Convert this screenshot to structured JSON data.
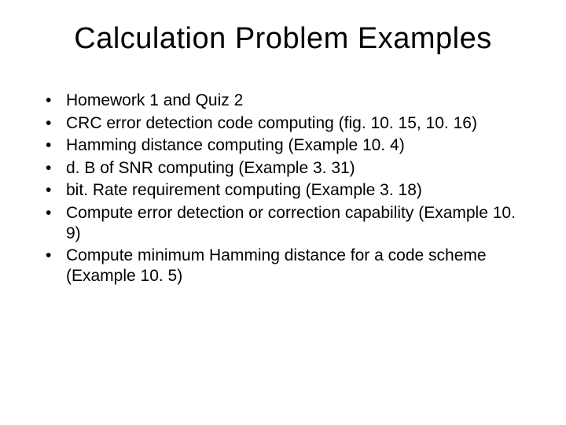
{
  "title": "Calculation Problem Examples",
  "bullets": [
    "Homework 1 and Quiz 2",
    "CRC error detection code computing (fig. 10. 15, 10. 16)",
    "Hamming distance computing (Example 10. 4)",
    "d. B of SNR computing (Example 3. 31)",
    "bit. Rate requirement computing (Example 3. 18)",
    "Compute error detection or correction capability (Example 10. 9)",
    "Compute minimum Hamming distance for a code scheme (Example 10. 5)"
  ]
}
